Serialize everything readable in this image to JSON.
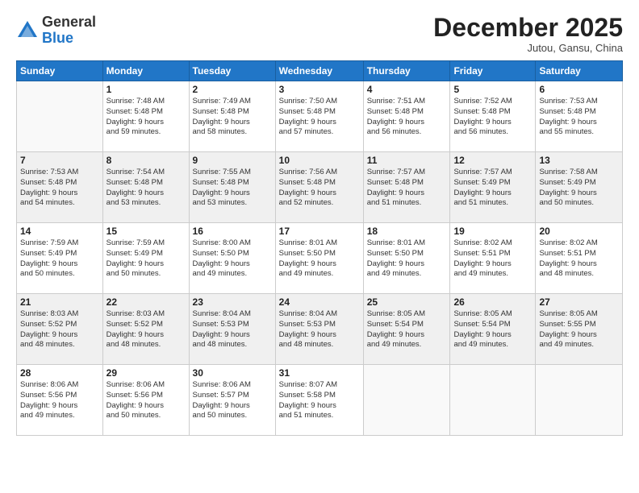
{
  "logo": {
    "general": "General",
    "blue": "Blue"
  },
  "header": {
    "month": "December 2025",
    "location": "Jutou, Gansu, China"
  },
  "weekdays": [
    "Sunday",
    "Monday",
    "Tuesday",
    "Wednesday",
    "Thursday",
    "Friday",
    "Saturday"
  ],
  "weeks": [
    [
      {
        "day": "",
        "sunrise": "",
        "sunset": "",
        "daylight": ""
      },
      {
        "day": "1",
        "sunrise": "Sunrise: 7:48 AM",
        "sunset": "Sunset: 5:48 PM",
        "daylight": "Daylight: 9 hours and 59 minutes."
      },
      {
        "day": "2",
        "sunrise": "Sunrise: 7:49 AM",
        "sunset": "Sunset: 5:48 PM",
        "daylight": "Daylight: 9 hours and 58 minutes."
      },
      {
        "day": "3",
        "sunrise": "Sunrise: 7:50 AM",
        "sunset": "Sunset: 5:48 PM",
        "daylight": "Daylight: 9 hours and 57 minutes."
      },
      {
        "day": "4",
        "sunrise": "Sunrise: 7:51 AM",
        "sunset": "Sunset: 5:48 PM",
        "daylight": "Daylight: 9 hours and 56 minutes."
      },
      {
        "day": "5",
        "sunrise": "Sunrise: 7:52 AM",
        "sunset": "Sunset: 5:48 PM",
        "daylight": "Daylight: 9 hours and 56 minutes."
      },
      {
        "day": "6",
        "sunrise": "Sunrise: 7:53 AM",
        "sunset": "Sunset: 5:48 PM",
        "daylight": "Daylight: 9 hours and 55 minutes."
      }
    ],
    [
      {
        "day": "7",
        "sunrise": "Sunrise: 7:53 AM",
        "sunset": "Sunset: 5:48 PM",
        "daylight": "Daylight: 9 hours and 54 minutes."
      },
      {
        "day": "8",
        "sunrise": "Sunrise: 7:54 AM",
        "sunset": "Sunset: 5:48 PM",
        "daylight": "Daylight: 9 hours and 53 minutes."
      },
      {
        "day": "9",
        "sunrise": "Sunrise: 7:55 AM",
        "sunset": "Sunset: 5:48 PM",
        "daylight": "Daylight: 9 hours and 53 minutes."
      },
      {
        "day": "10",
        "sunrise": "Sunrise: 7:56 AM",
        "sunset": "Sunset: 5:48 PM",
        "daylight": "Daylight: 9 hours and 52 minutes."
      },
      {
        "day": "11",
        "sunrise": "Sunrise: 7:57 AM",
        "sunset": "Sunset: 5:48 PM",
        "daylight": "Daylight: 9 hours and 51 minutes."
      },
      {
        "day": "12",
        "sunrise": "Sunrise: 7:57 AM",
        "sunset": "Sunset: 5:49 PM",
        "daylight": "Daylight: 9 hours and 51 minutes."
      },
      {
        "day": "13",
        "sunrise": "Sunrise: 7:58 AM",
        "sunset": "Sunset: 5:49 PM",
        "daylight": "Daylight: 9 hours and 50 minutes."
      }
    ],
    [
      {
        "day": "14",
        "sunrise": "Sunrise: 7:59 AM",
        "sunset": "Sunset: 5:49 PM",
        "daylight": "Daylight: 9 hours and 50 minutes."
      },
      {
        "day": "15",
        "sunrise": "Sunrise: 7:59 AM",
        "sunset": "Sunset: 5:49 PM",
        "daylight": "Daylight: 9 hours and 50 minutes."
      },
      {
        "day": "16",
        "sunrise": "Sunrise: 8:00 AM",
        "sunset": "Sunset: 5:50 PM",
        "daylight": "Daylight: 9 hours and 49 minutes."
      },
      {
        "day": "17",
        "sunrise": "Sunrise: 8:01 AM",
        "sunset": "Sunset: 5:50 PM",
        "daylight": "Daylight: 9 hours and 49 minutes."
      },
      {
        "day": "18",
        "sunrise": "Sunrise: 8:01 AM",
        "sunset": "Sunset: 5:50 PM",
        "daylight": "Daylight: 9 hours and 49 minutes."
      },
      {
        "day": "19",
        "sunrise": "Sunrise: 8:02 AM",
        "sunset": "Sunset: 5:51 PM",
        "daylight": "Daylight: 9 hours and 49 minutes."
      },
      {
        "day": "20",
        "sunrise": "Sunrise: 8:02 AM",
        "sunset": "Sunset: 5:51 PM",
        "daylight": "Daylight: 9 hours and 48 minutes."
      }
    ],
    [
      {
        "day": "21",
        "sunrise": "Sunrise: 8:03 AM",
        "sunset": "Sunset: 5:52 PM",
        "daylight": "Daylight: 9 hours and 48 minutes."
      },
      {
        "day": "22",
        "sunrise": "Sunrise: 8:03 AM",
        "sunset": "Sunset: 5:52 PM",
        "daylight": "Daylight: 9 hours and 48 minutes."
      },
      {
        "day": "23",
        "sunrise": "Sunrise: 8:04 AM",
        "sunset": "Sunset: 5:53 PM",
        "daylight": "Daylight: 9 hours and 48 minutes."
      },
      {
        "day": "24",
        "sunrise": "Sunrise: 8:04 AM",
        "sunset": "Sunset: 5:53 PM",
        "daylight": "Daylight: 9 hours and 48 minutes."
      },
      {
        "day": "25",
        "sunrise": "Sunrise: 8:05 AM",
        "sunset": "Sunset: 5:54 PM",
        "daylight": "Daylight: 9 hours and 49 minutes."
      },
      {
        "day": "26",
        "sunrise": "Sunrise: 8:05 AM",
        "sunset": "Sunset: 5:54 PM",
        "daylight": "Daylight: 9 hours and 49 minutes."
      },
      {
        "day": "27",
        "sunrise": "Sunrise: 8:05 AM",
        "sunset": "Sunset: 5:55 PM",
        "daylight": "Daylight: 9 hours and 49 minutes."
      }
    ],
    [
      {
        "day": "28",
        "sunrise": "Sunrise: 8:06 AM",
        "sunset": "Sunset: 5:56 PM",
        "daylight": "Daylight: 9 hours and 49 minutes."
      },
      {
        "day": "29",
        "sunrise": "Sunrise: 8:06 AM",
        "sunset": "Sunset: 5:56 PM",
        "daylight": "Daylight: 9 hours and 50 minutes."
      },
      {
        "day": "30",
        "sunrise": "Sunrise: 8:06 AM",
        "sunset": "Sunset: 5:57 PM",
        "daylight": "Daylight: 9 hours and 50 minutes."
      },
      {
        "day": "31",
        "sunrise": "Sunrise: 8:07 AM",
        "sunset": "Sunset: 5:58 PM",
        "daylight": "Daylight: 9 hours and 51 minutes."
      },
      {
        "day": "",
        "sunrise": "",
        "sunset": "",
        "daylight": ""
      },
      {
        "day": "",
        "sunrise": "",
        "sunset": "",
        "daylight": ""
      },
      {
        "day": "",
        "sunrise": "",
        "sunset": "",
        "daylight": ""
      }
    ]
  ]
}
